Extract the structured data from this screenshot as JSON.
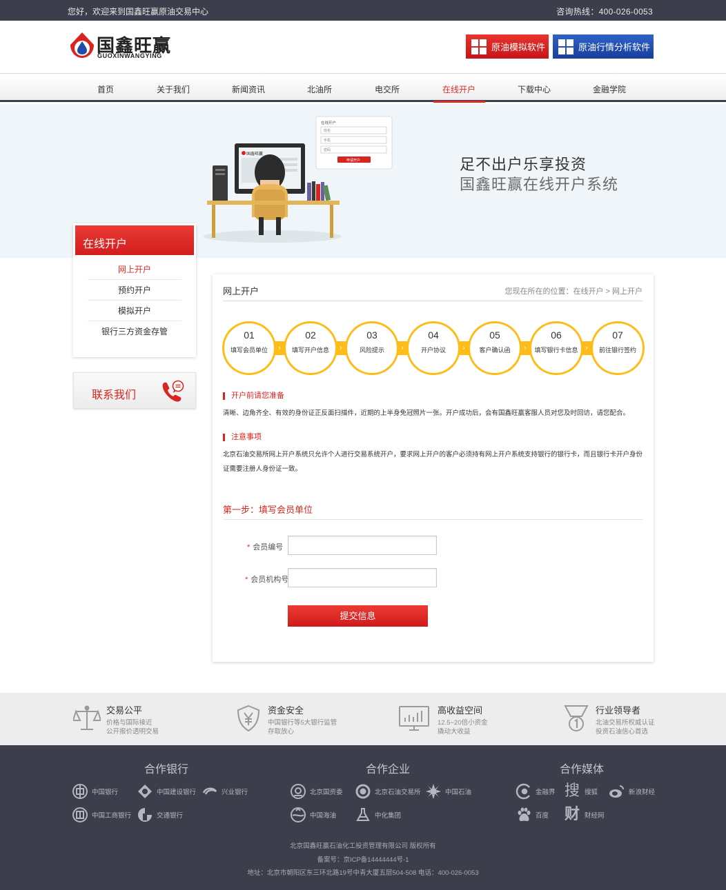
{
  "topbar": {
    "welcome": "您好，欢迎来到国鑫旺赢原油交易中心",
    "hotline": "咨询热线：400-026-0053"
  },
  "logo": {
    "name_cn": "国鑫旺赢",
    "name_en": "GUOXINWANGYING"
  },
  "header_buttons": {
    "sim_software": "原油模拟软件",
    "analysis_software": "原油行情分析软件"
  },
  "nav": [
    "首页",
    "关于我们",
    "新闻资讯",
    "北油所",
    "电交所",
    "在线开户",
    "下载中心",
    "金融学院"
  ],
  "banner": {
    "slogan_line1": "足不出户乐享投资",
    "slogan_line2": "国鑫旺赢在线开户系统",
    "illustration_form": {
      "title": "在线开户",
      "fields": [
        "姓名",
        "手机",
        "密码"
      ],
      "button": "申请开户"
    },
    "screen_logo": "国鑫旺赢"
  },
  "sidebar": {
    "title": "在线开户",
    "items": [
      "网上开户",
      "预约开户",
      "模拟开户",
      "银行三方资金存管"
    ],
    "contact_label": "联系我们"
  },
  "panel": {
    "title": "网上开户",
    "breadcrumb": "您现在所在的位置：在线开户 > 网上开户",
    "steps": [
      {
        "num": "01",
        "label": "填写会员单位"
      },
      {
        "num": "02",
        "label": "填写开户信息"
      },
      {
        "num": "03",
        "label": "风险提示"
      },
      {
        "num": "04",
        "label": "开户协议"
      },
      {
        "num": "05",
        "label": "客户确认函"
      },
      {
        "num": "06",
        "label": "填写银行卡信息"
      },
      {
        "num": "07",
        "label": "前往银行签约"
      }
    ],
    "prep_title": "开户前请您准备",
    "prep_text": "清晰、边角齐全、有效的身份证正反面扫描件，近期的上半身免冠照片一张。开户成功后，会有国鑫旺赢客服人员对您及时回访，请您配合。",
    "notice_title": "注意事项",
    "notice_text": "北京石油交易所网上开户系统只允许个人进行交易系统开户，要求网上开户的客户必须持有网上开户系统支持银行的银行卡，而且银行卡开户身份证需要注册人身份证一致。",
    "step_heading": "第一步：填写会员单位",
    "form": {
      "member_no_label": "会员编号",
      "member_no_value": "",
      "member_org_label": "会员机构号",
      "member_org_value": "",
      "required_mark": "*",
      "submit": "提交信息"
    }
  },
  "features": [
    {
      "icon": "scale-icon",
      "title": "交易公平",
      "desc1": "价格与国际接近",
      "desc2": "公开报价透明交易"
    },
    {
      "icon": "yuan-shield-icon",
      "title": "资金安全",
      "desc1": "中国银行等5大银行监管",
      "desc2": "存取放心"
    },
    {
      "icon": "chart-monitor-icon",
      "title": "高收益空间",
      "desc1": "12.5~20倍小资金",
      "desc2": "撬动大收益"
    },
    {
      "icon": "medal-icon",
      "title": "行业领导者",
      "desc1": "北油交易所权威认证",
      "desc2": "投资石油信心首选"
    }
  ],
  "footer": {
    "banks_title": "合作银行",
    "banks": [
      "中国银行",
      "中国建设银行",
      "兴业银行",
      "中国工商银行",
      "交通银行"
    ],
    "companies_title": "合作企业",
    "companies": [
      "北京国资委",
      "北京石油交易所",
      "中国石油",
      "中国海油",
      "中化集团"
    ],
    "media_title": "合作媒体",
    "media": [
      "金融界",
      "搜狐",
      "新浪财经",
      "百度",
      "财经网"
    ],
    "copyright": "北京国鑫旺赢石油化工投资管理有限公司 版权所有",
    "icp": "备案号：京ICP备14444444号-1",
    "address": "地址：北京市朝阳区东三环北路19号中青大厦五层504-508 电话：400-026-0053"
  },
  "colors": {
    "brand_red": "#e02a26",
    "dark_bar": "#3c3e4b",
    "step_yellow": "#ffbb16",
    "button_blue": "#173e9c"
  }
}
